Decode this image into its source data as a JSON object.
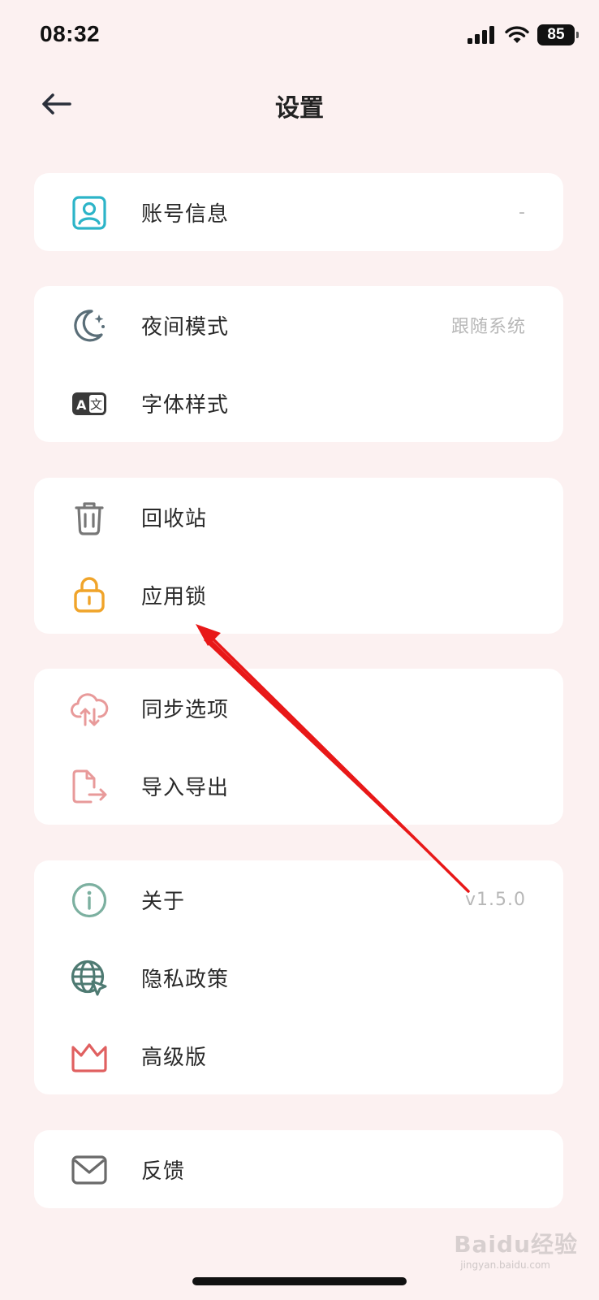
{
  "status_bar": {
    "time": "08:32",
    "battery": "85"
  },
  "nav": {
    "title": "设置",
    "back_icon": "arrow-left-icon"
  },
  "sections": [
    {
      "items": [
        {
          "label": "账号信息",
          "value": "-",
          "icon": "account-icon",
          "icon_color": "#2cb4c8"
        }
      ]
    },
    {
      "items": [
        {
          "label": "夜间模式",
          "value": "跟随系统",
          "icon": "moon-icon",
          "icon_color": "#5a6e78"
        },
        {
          "label": "字体样式",
          "value": "",
          "icon": "font-translate-icon",
          "icon_color": "#3a3a3a"
        }
      ]
    },
    {
      "items": [
        {
          "label": "回收站",
          "value": "",
          "icon": "trash-icon",
          "icon_color": "#777777"
        },
        {
          "label": "应用锁",
          "value": "",
          "icon": "lock-icon",
          "icon_color": "#f0a42a"
        }
      ]
    },
    {
      "items": [
        {
          "label": "同步选项",
          "value": "",
          "icon": "cloud-sync-icon",
          "icon_color": "#e89a9a"
        },
        {
          "label": "导入导出",
          "value": "",
          "icon": "file-export-icon",
          "icon_color": "#e89a9a"
        }
      ]
    },
    {
      "items": [
        {
          "label": "关于",
          "value": "v1.5.0",
          "icon": "info-icon",
          "icon_color": "#7cb0a0"
        },
        {
          "label": "隐私政策",
          "value": "",
          "icon": "globe-cursor-icon",
          "icon_color": "#4e7a72"
        },
        {
          "label": "高级版",
          "value": "",
          "icon": "crown-icon",
          "icon_color": "#e06060"
        }
      ]
    },
    {
      "items": [
        {
          "label": "反馈",
          "value": "",
          "icon": "mail-icon",
          "icon_color": "#6a6a6a"
        }
      ]
    }
  ],
  "annotation": {
    "color": "#e81818"
  },
  "watermark": {
    "text": "Baidu经验",
    "sub": "jingyan.baidu.com"
  }
}
